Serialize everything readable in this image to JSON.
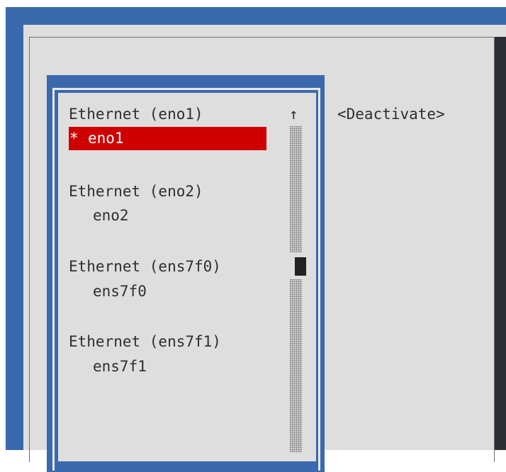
{
  "connections": [
    {
      "title": "Ethernet (eno1)",
      "device": "eno1",
      "marker": "* ",
      "selected": true
    },
    {
      "title": "Ethernet (eno2)",
      "device": "eno2",
      "marker": "",
      "selected": false
    },
    {
      "title": "Ethernet (ens7f0)",
      "device": "ens7f0",
      "marker": "",
      "selected": false
    },
    {
      "title": "Ethernet (ens7f1)",
      "device": "ens7f1",
      "marker": "",
      "selected": false
    }
  ],
  "buttons": {
    "deactivate": "<Deactivate>"
  },
  "scrollbar": {
    "up_arrow": "↑"
  },
  "colors": {
    "background_blue": "#3a69ad",
    "dialog_gray": "#dedede",
    "selection_red": "#cf0000",
    "text": "#2e2e2e"
  }
}
